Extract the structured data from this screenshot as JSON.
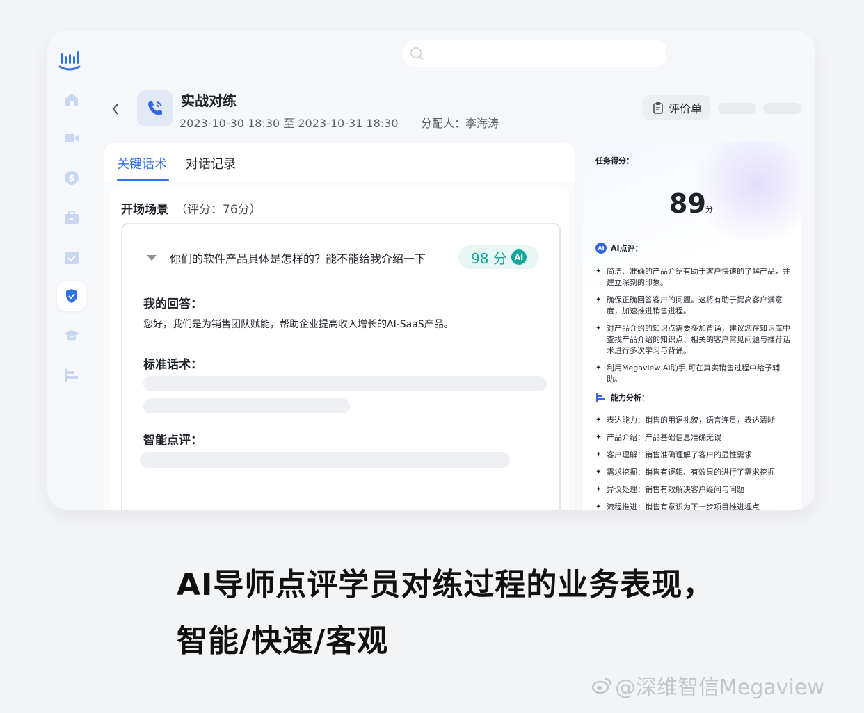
{
  "header": {
    "search_placeholder": "",
    "task_title": "实战对练",
    "time_range": "2023-10-30 18:30  至  2023-10-31 18:30",
    "assignee": "分配人：李海涛",
    "eval_button": "评价单"
  },
  "sidebar": {
    "items": [
      {
        "icon": "home-icon",
        "active": false
      },
      {
        "icon": "video-icon",
        "active": false
      },
      {
        "icon": "dollar-icon",
        "active": false
      },
      {
        "icon": "briefcase-icon",
        "active": false
      },
      {
        "icon": "calendar-check-icon",
        "active": false
      },
      {
        "icon": "shield-check-icon",
        "active": true
      },
      {
        "icon": "graduation-cap-icon",
        "active": false
      },
      {
        "icon": "bar-list-icon",
        "active": false
      }
    ]
  },
  "tabs": [
    {
      "label": "关键话术",
      "active": true
    },
    {
      "label": "对话记录",
      "active": false
    }
  ],
  "section": {
    "title": "开场场景",
    "score": "（评分：76分）",
    "question": "你们的软件产品具体是怎样的？能不能给我介绍一下",
    "question_score": "98 分",
    "ai_badge": "AI",
    "my_answer_label": "我的回答：",
    "my_answer": "您好，我们是为销售团队赋能，帮助企业提高收入增长的AI-SaaS产品。",
    "standard_label": "标准话术：",
    "smart_label": "智能点评："
  },
  "review": {
    "task_score_label": "任务得分：",
    "score": "89",
    "unit": "分",
    "ai_review_label": "AI点评：",
    "ai_points": [
      "简洁、准确的产品介绍有助于客户快速的了解产品，并建立深刻的印象。",
      "确保正确回答客户的问题。这将有助于提高客户满意度，加速推进销售进程。",
      "对产品介绍的知识点需要多加背诵，建议您在知识库中查找产品介绍的知识点、相关的客户常见问题与推荐话术进行多次学习与背诵。",
      "利用Megaview AI助手,可在真实销售过程中给予辅助。"
    ],
    "ability_label": "能力分析：",
    "abilities": [
      "表达能力：销售的用语礼貌，语言连贯，表达清晰",
      "产品介绍：产品基础信息准确无误",
      "客户理解：销售准确理解了客户的显性需求",
      "需求挖掘：销售有逻辑、有效果的进行了需求挖掘",
      "异议处理：销售有效解决客户疑问与问题",
      "流程推进：销售有意识为下一步项目推进埋点"
    ]
  },
  "caption": {
    "line1": "AI导师点评学员对练过程的业务表现，",
    "line2": "智能/快速/客观"
  },
  "watermark": "@深维智信Megaview",
  "colors": {
    "accent": "#2f6fe8",
    "score_green": "#12a89a",
    "ai_blue": "#3567e0"
  }
}
